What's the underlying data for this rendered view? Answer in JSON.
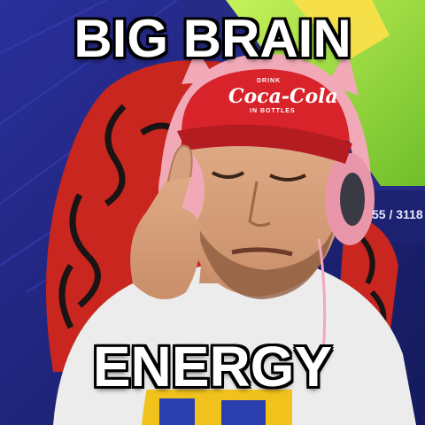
{
  "meme": {
    "top_caption": "BIG BRAIN",
    "bottom_caption": "ENERGY"
  },
  "cap": {
    "brand_top": "DRINK",
    "brand_logo": "Coca-Cola",
    "brand_bottom": "IN BOTTLES"
  },
  "monitor": {
    "counter_text": "55 / 3118"
  },
  "colors": {
    "background": "#1f2a8c",
    "cap_red": "#d8232a",
    "headset_pink": "#f1a9b8",
    "chair_red": "#c8261e",
    "chair_dark": "#1a1414",
    "monitor_green": "#9fe03a",
    "shirt": "#ececec",
    "skin": "#d6a27e"
  }
}
